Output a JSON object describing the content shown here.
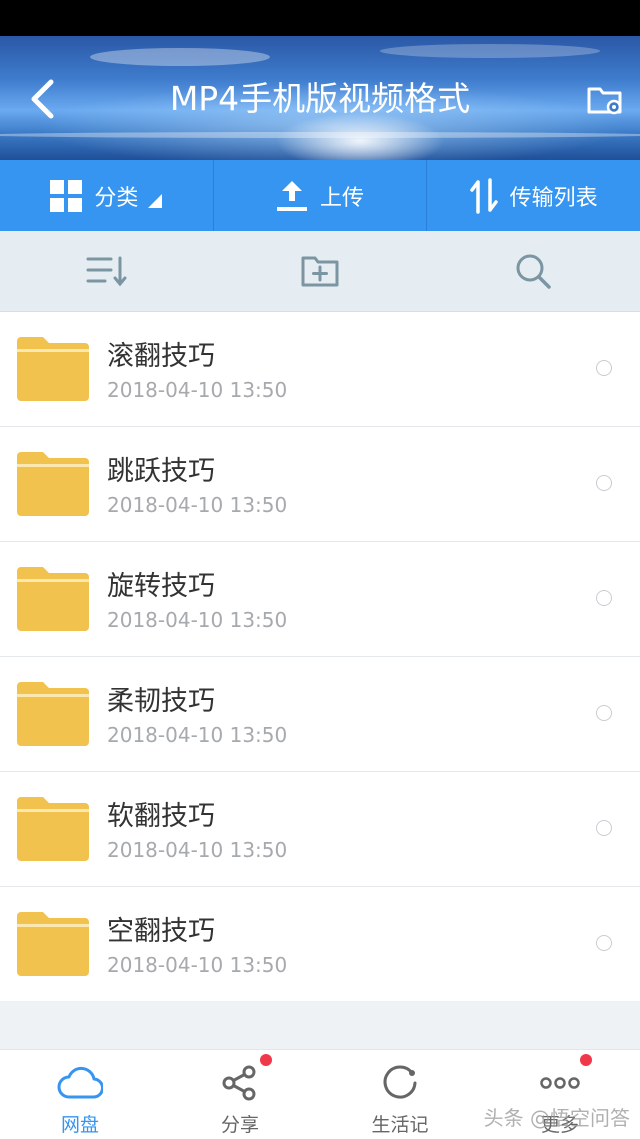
{
  "header": {
    "title": "MP4手机版视频格式"
  },
  "toolbar": {
    "category_label": "分类",
    "upload_label": "上传",
    "transfer_label": "传输列表"
  },
  "files": [
    {
      "name": "滚翻技巧",
      "date": "2018-04-10  13:50"
    },
    {
      "name": "跳跃技巧",
      "date": "2018-04-10  13:50"
    },
    {
      "name": "旋转技巧",
      "date": "2018-04-10  13:50"
    },
    {
      "name": "柔韧技巧",
      "date": "2018-04-10  13:50"
    },
    {
      "name": "软翻技巧",
      "date": "2018-04-10  13:50"
    },
    {
      "name": "空翻技巧",
      "date": "2018-04-10  13:50"
    }
  ],
  "nav": {
    "items": [
      {
        "label": "网盘",
        "icon": "cloud-icon"
      },
      {
        "label": "分享",
        "icon": "share-icon"
      },
      {
        "label": "生活记",
        "icon": "life-icon"
      },
      {
        "label": "更多",
        "icon": "more-icon"
      }
    ]
  },
  "watermark": "头条 @悟空问答",
  "colors": {
    "accent": "#3595f0",
    "folder": "#f2c24f",
    "badge": "#f0384b"
  }
}
